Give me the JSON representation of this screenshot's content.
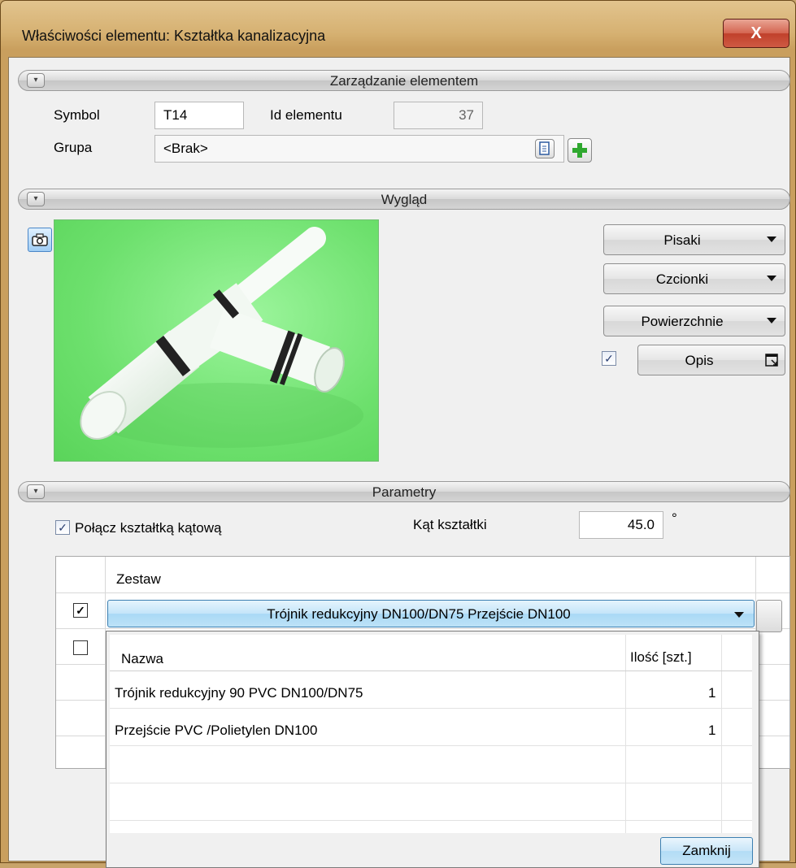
{
  "window": {
    "title": "Właściwości elementu: Kształtka kanalizacyjna",
    "close_label": "X"
  },
  "management": {
    "section_label": "Zarządzanie elementem",
    "symbol_label": "Symbol",
    "symbol_value": "T14",
    "id_label": "Id elementu",
    "id_value": "37",
    "group_label": "Grupa",
    "group_value": "<Brak>"
  },
  "appearance": {
    "section_label": "Wygląd",
    "pens_label": "Pisaki",
    "fonts_label": "Czcionki",
    "surfaces_label": "Powierzchnie",
    "description_label": "Opis",
    "description_checked": true
  },
  "parameters": {
    "section_label": "Parametry",
    "connect_label": "Połącz kształtką kątową",
    "connect_checked": true,
    "angle_label": "Kąt kształtki",
    "angle_value": "45.0",
    "angle_unit": "°"
  },
  "set_grid": {
    "header": "Zestaw",
    "rows": [
      {
        "checked": true,
        "value": "Trójnik redukcyjny DN100/DN75  Przejście DN100"
      },
      {
        "checked": false,
        "value": ""
      }
    ]
  },
  "popup": {
    "col_name": "Nazwa",
    "col_qty": "Ilość [szt.]",
    "items": [
      {
        "name": "Trójnik redukcyjny 90 PVC  DN100/DN75",
        "qty": "1"
      },
      {
        "name": "Przejście PVC /Polietylen  DN100",
        "qty": "1"
      }
    ],
    "close_label": "Zamknij"
  },
  "icons": {
    "collapse": "chevron-collapse-icon",
    "camera": "camera-icon",
    "document": "document-icon",
    "add": "plus-icon",
    "popout": "popout-icon"
  }
}
